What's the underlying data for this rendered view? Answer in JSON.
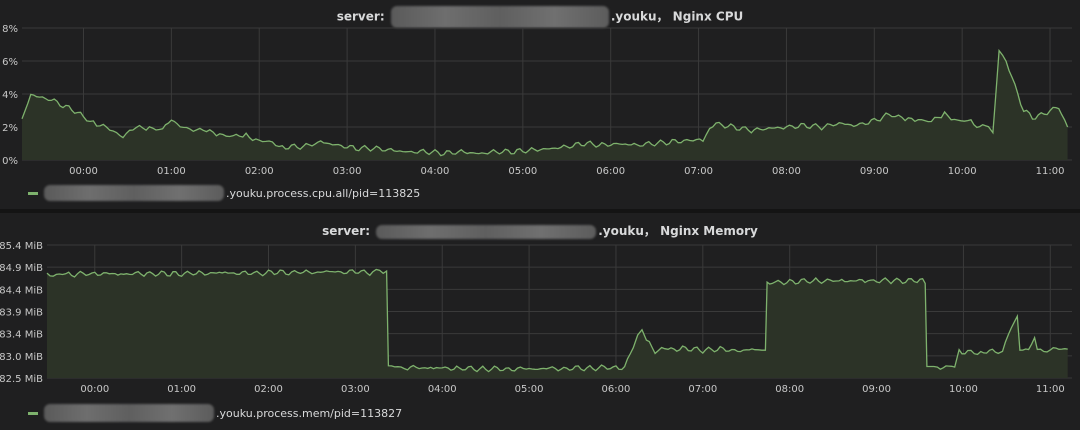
{
  "cpu_panel": {
    "title_prefix": "server:",
    "title_suffix": ".youku， Nginx CPU",
    "legend": ".youku.process.cpu.all/pid=113825"
  },
  "mem_panel": {
    "title_prefix": "server:",
    "title_suffix": ".youku， Nginx Memory",
    "legend": ".youku.process.mem/pid=113827"
  },
  "colors": {
    "series": "#7eb26d",
    "fill": "#2c3327",
    "grid": "#3a3a3a",
    "background": "#1f1f20"
  },
  "chart_data": [
    {
      "type": "area",
      "title": "",
      "x_ticks": [
        "00:00",
        "01:00",
        "02:00",
        "03:00",
        "04:00",
        "05:00",
        "06:00",
        "07:00",
        "08:00",
        "09:00",
        "10:00",
        "11:00"
      ],
      "x_range": [
        -0.7,
        11.25
      ],
      "y_ticks": [
        "0%",
        "2%",
        "4%",
        "6%",
        "8%"
      ],
      "ylim": [
        0,
        8
      ],
      "grid": true,
      "legend_position": "bottom-left",
      "series": [
        {
          "name": ".youku.process.cpu.all/pid=113825",
          "x": [
            -0.7,
            -0.6,
            -0.5,
            -0.4,
            -0.3,
            -0.2,
            -0.1,
            0.0,
            0.15,
            0.3,
            0.45,
            0.6,
            0.75,
            0.9,
            1.0,
            1.1,
            1.25,
            1.4,
            1.55,
            1.7,
            1.85,
            2.0,
            2.15,
            2.3,
            2.5,
            2.7,
            2.9,
            3.1,
            3.3,
            3.5,
            3.7,
            3.9,
            4.1,
            4.3,
            4.5,
            4.7,
            4.9,
            5.1,
            5.3,
            5.5,
            5.7,
            5.9,
            6.1,
            6.3,
            6.5,
            6.7,
            6.9,
            7.05,
            7.2,
            7.4,
            7.6,
            7.8,
            8.0,
            8.2,
            8.4,
            8.6,
            8.8,
            9.0,
            9.1,
            9.2,
            9.35,
            9.5,
            9.65,
            9.8,
            9.95,
            10.1,
            10.2,
            10.3,
            10.35,
            10.42,
            10.5,
            10.6,
            10.7,
            10.8,
            10.9,
            11.0,
            11.1,
            11.2
          ],
          "values": [
            2.4,
            4.0,
            3.8,
            3.7,
            3.5,
            3.2,
            3.0,
            2.6,
            2.2,
            1.8,
            1.5,
            1.9,
            2.0,
            1.8,
            2.5,
            2.0,
            1.9,
            1.7,
            1.6,
            1.4,
            1.5,
            1.2,
            1.0,
            0.8,
            0.8,
            1.1,
            0.9,
            0.7,
            0.7,
            0.6,
            0.5,
            0.5,
            0.4,
            0.5,
            0.4,
            0.5,
            0.5,
            0.6,
            0.7,
            0.8,
            1.0,
            0.9,
            1.0,
            0.9,
            1.0,
            1.1,
            1.2,
            1.3,
            2.2,
            2.0,
            1.8,
            1.9,
            2.0,
            2.1,
            2.0,
            2.2,
            2.1,
            2.4,
            2.6,
            2.8,
            2.4,
            2.5,
            2.3,
            2.8,
            2.4,
            2.3,
            2.0,
            2.1,
            1.5,
            6.8,
            6.0,
            4.5,
            3.0,
            2.6,
            2.7,
            3.0,
            3.2,
            2.0
          ]
        }
      ]
    },
    {
      "type": "area",
      "title": "",
      "x_ticks": [
        "00:00",
        "01:00",
        "02:00",
        "03:00",
        "04:00",
        "05:00",
        "06:00",
        "07:00",
        "08:00",
        "09:00",
        "10:00",
        "11:00"
      ],
      "x_range": [
        -0.55,
        11.25
      ],
      "y_ticks": [
        "82.5 MiB",
        "83.0 MiB",
        "83.4 MiB",
        "83.9 MiB",
        "84.4 MiB",
        "84.9 MiB",
        "85.4 MiB"
      ],
      "ylim": [
        82.5,
        85.4
      ],
      "grid": true,
      "legend_position": "bottom-left",
      "series": [
        {
          "name": ".youku.process.mem/pid=113827",
          "x": [
            -0.55,
            -0.3,
            0.0,
            0.3,
            0.6,
            0.9,
            1.2,
            1.5,
            1.8,
            2.1,
            2.4,
            2.7,
            3.0,
            3.2,
            3.28,
            3.36,
            3.38,
            3.6,
            3.9,
            4.2,
            4.5,
            4.8,
            5.1,
            5.4,
            5.7,
            6.0,
            6.1,
            6.2,
            6.25,
            6.3,
            6.35,
            6.45,
            6.6,
            6.8,
            7.0,
            7.2,
            7.4,
            7.6,
            7.72,
            7.74,
            7.8,
            8.0,
            8.3,
            8.6,
            8.9,
            9.2,
            9.5,
            9.56,
            9.58,
            9.7,
            9.9,
            9.95,
            10.05,
            10.2,
            10.4,
            10.45,
            10.55,
            10.62,
            10.65,
            10.75,
            10.82,
            10.85,
            11.0,
            11.1,
            11.2
          ],
          "values": [
            84.75,
            84.76,
            84.78,
            84.77,
            84.78,
            84.77,
            84.78,
            84.79,
            84.78,
            84.8,
            84.8,
            84.81,
            84.81,
            84.8,
            84.82,
            84.79,
            82.75,
            82.73,
            82.72,
            82.71,
            82.7,
            82.7,
            82.71,
            82.71,
            82.72,
            82.73,
            82.72,
            83.2,
            83.4,
            83.55,
            83.3,
            83.1,
            83.12,
            83.15,
            83.1,
            83.13,
            83.1,
            83.12,
            83.11,
            84.55,
            84.58,
            84.6,
            84.62,
            84.62,
            84.62,
            84.62,
            84.62,
            84.6,
            82.75,
            82.73,
            82.76,
            83.1,
            83.05,
            83.07,
            83.08,
            83.1,
            83.6,
            83.85,
            83.1,
            83.12,
            83.4,
            83.1,
            83.12,
            83.15,
            83.13
          ]
        }
      ]
    }
  ]
}
